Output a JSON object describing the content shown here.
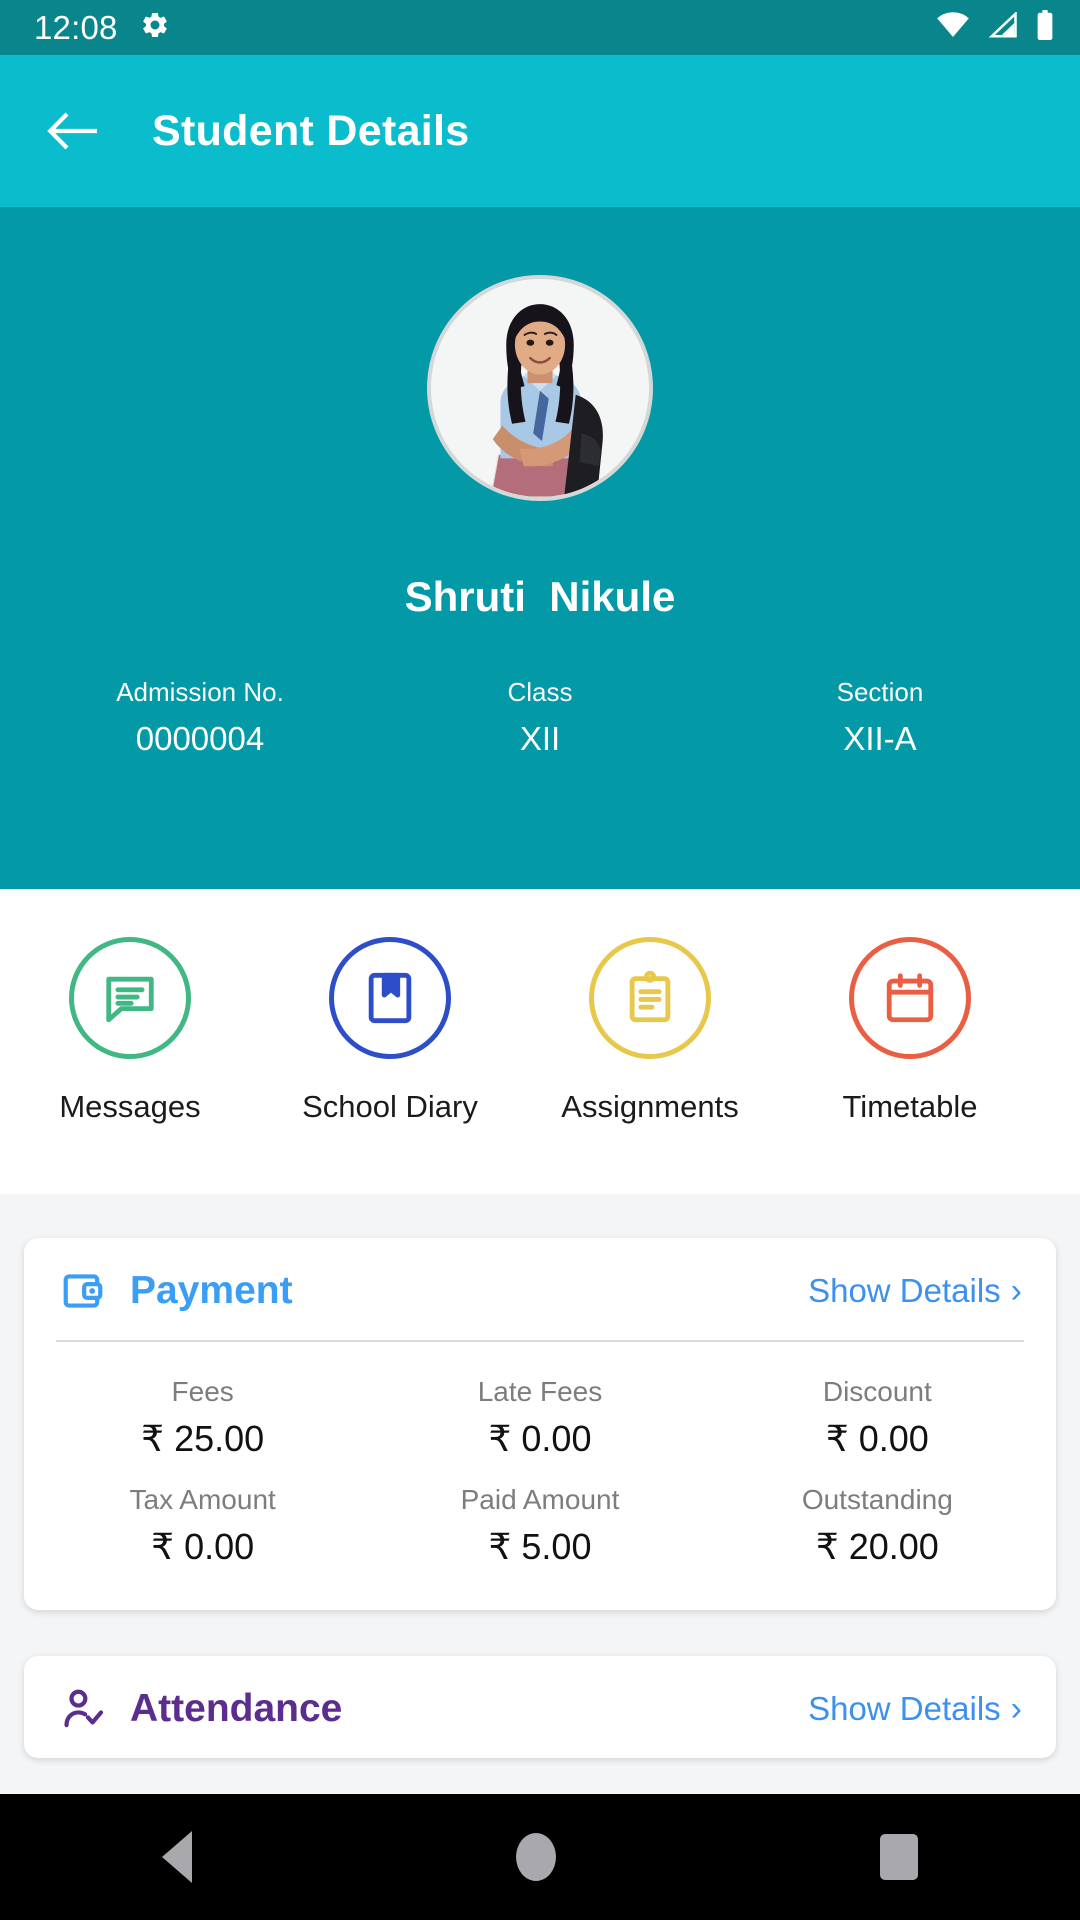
{
  "statusbar": {
    "time": "12:08",
    "icons": [
      "gear-icon",
      "wifi-icon",
      "cellular-signal-icon",
      "battery-icon"
    ]
  },
  "appbar": {
    "title": "Student Details",
    "back_icon": "arrow-left-icon"
  },
  "profile": {
    "avatar_alt": "student-photo",
    "name": "Shruti  Nikule",
    "meta": [
      {
        "label": "Admission No.",
        "value": "0000004"
      },
      {
        "label": "Class",
        "value": "XII"
      },
      {
        "label": "Section",
        "value": "XII-A"
      }
    ]
  },
  "quick_actions": [
    {
      "label": "Messages",
      "icon": "chat-bubble-icon",
      "color": "#41b883"
    },
    {
      "label": "School Diary",
      "icon": "book-bookmark-icon",
      "color": "#2d4ec8"
    },
    {
      "label": "Assignments",
      "icon": "clipboard-icon",
      "color": "#e7c84b"
    },
    {
      "label": "Timetable",
      "icon": "calendar-icon",
      "color": "#ea5f43"
    }
  ],
  "cards": [
    {
      "title": "Payment",
      "title_color": "#3b9ef5",
      "icon": "wallet-icon",
      "show_details": "Show Details",
      "chevron": "›",
      "rows": [
        [
          {
            "label": "Fees",
            "value": "₹ 25.00"
          },
          {
            "label": "Late Fees",
            "value": "₹ 0.00"
          },
          {
            "label": "Discount",
            "value": "₹ 0.00"
          }
        ],
        [
          {
            "label": "Tax Amount",
            "value": "₹ 0.00"
          },
          {
            "label": "Paid Amount",
            "value": "₹ 5.00"
          },
          {
            "label": "Outstanding",
            "value": "₹ 20.00"
          }
        ]
      ]
    },
    {
      "title": "Attendance",
      "title_color": "#5b2d8e",
      "icon": "person-check-icon",
      "show_details": "Show Details",
      "chevron": "›",
      "rows": []
    }
  ],
  "navbar": {
    "back": "nav-back-icon",
    "home": "nav-home-icon",
    "recents": "nav-recents-icon"
  },
  "colors": {
    "status_bar": "#08868c",
    "app_bar": "#0bbccd",
    "profile_bg": "#0399a6",
    "page_bg": "#f4f5f6",
    "link": "#3b90f0"
  }
}
